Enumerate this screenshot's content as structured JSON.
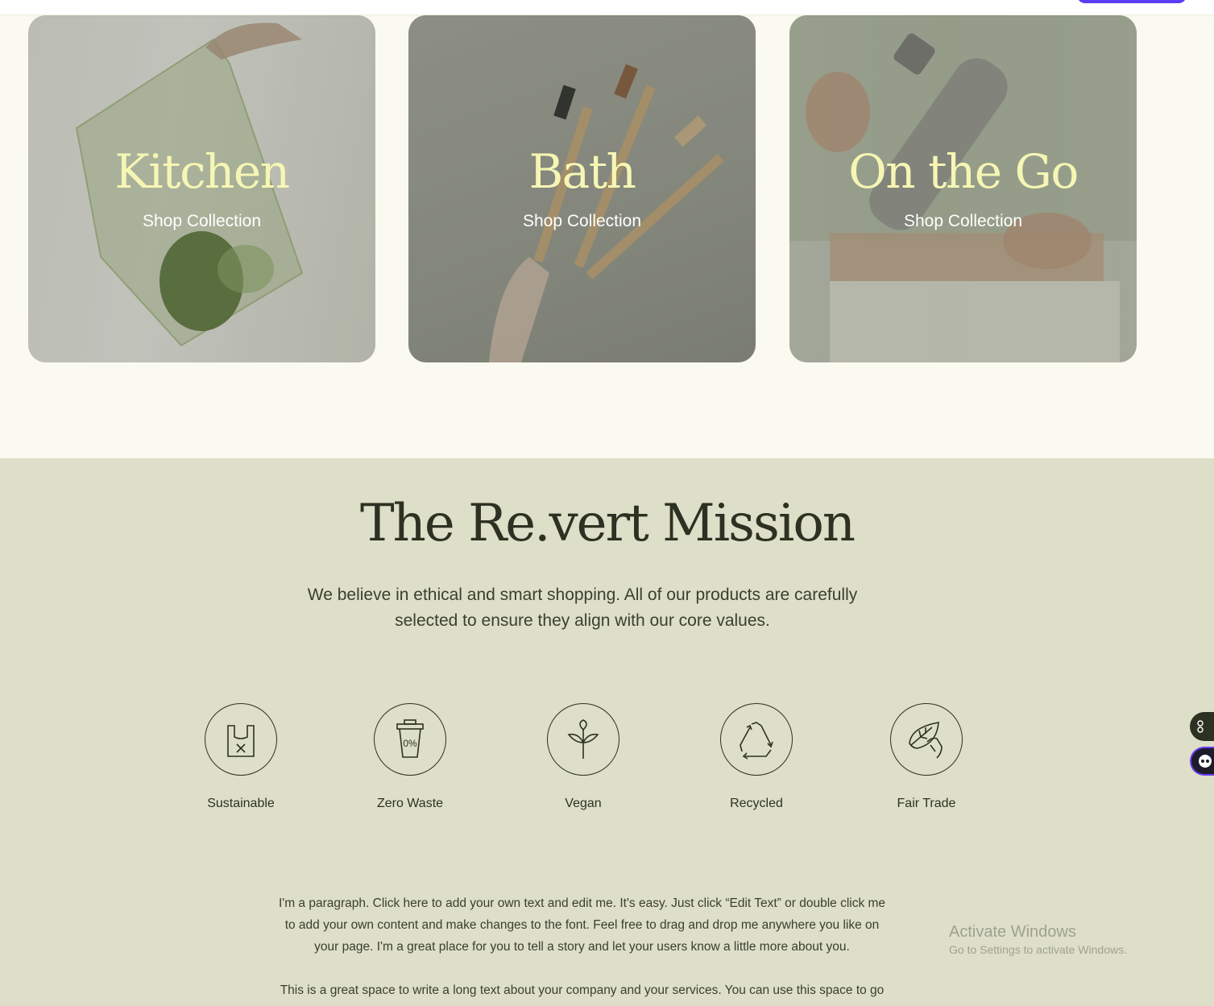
{
  "collections": [
    {
      "title": "Kitchen",
      "link": "Shop Collection"
    },
    {
      "title": "Bath",
      "link": "Shop Collection"
    },
    {
      "title": "On the Go",
      "link": "Shop Collection"
    }
  ],
  "mission": {
    "title": "The Re.vert Mission",
    "intro": "We believe in ethical and smart shopping. All of our products are carefully selected to ensure they align with our core values.",
    "values": [
      {
        "label": "Sustainable",
        "icon": "shopping-bag-icon"
      },
      {
        "label": "Zero Waste",
        "icon": "cup-zero-percent-icon",
        "icon_text": "0%"
      },
      {
        "label": "Vegan",
        "icon": "sprout-icon"
      },
      {
        "label": "Recycled",
        "icon": "recycle-icon"
      },
      {
        "label": "Fair Trade",
        "icon": "hand-leaf-icon"
      }
    ],
    "paragraph_1": "I'm a paragraph. Click here to add your own text and edit me. It's easy. Just click “Edit Text” or double click me to add your own content and make changes to the font. Feel free to drag and drop me anywhere you like on your page. I'm a great place for you to tell a story and let your users know a little more about you.",
    "paragraph_2": "This is a great space to write a long text about your company and your services. You can use this space to go"
  },
  "watermark": {
    "line1": "Activate Windows",
    "line2": "Go to Settings to activate Windows."
  },
  "colors": {
    "accent_text": "#f6f6b4",
    "mission_bg": "#dddfc9",
    "dark": "#2d3121",
    "page_bg": "#fafaf0"
  }
}
